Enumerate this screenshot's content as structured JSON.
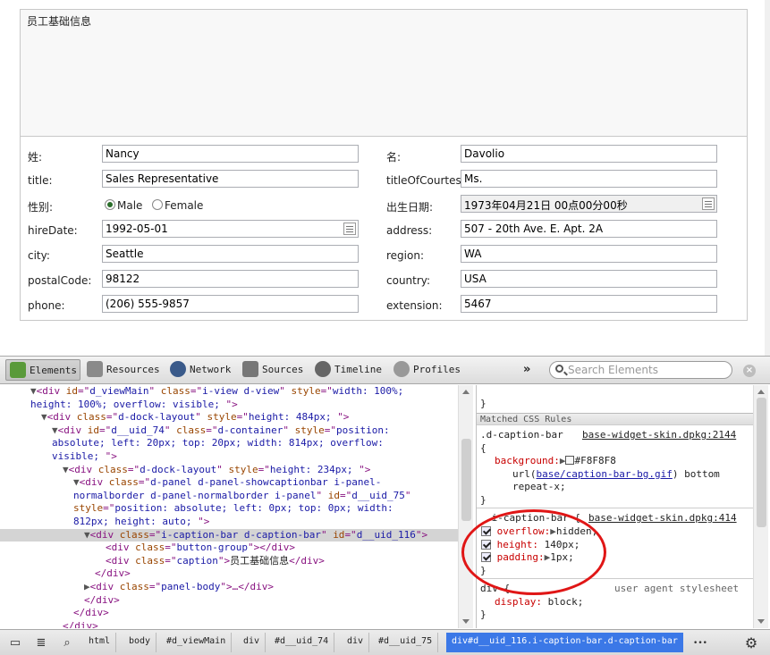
{
  "panel": {
    "caption": "员工基础信息",
    "fields": {
      "lastname": {
        "label": "姓:",
        "value": "Nancy"
      },
      "firstname": {
        "label": "名:",
        "value": "Davolio"
      },
      "title": {
        "label": "title:",
        "value": "Sales Representative"
      },
      "titleOfCourtesy": {
        "label": "titleOfCourtesy",
        "value": "Ms."
      },
      "gender": {
        "label": "性别:",
        "male": "Male",
        "female": "Female",
        "selected": "Male"
      },
      "birthdate": {
        "label": "出生日期:",
        "value": "1973年04月21日 00点00分00秒"
      },
      "hireDate": {
        "label": "hireDate:",
        "value": "1992-05-01"
      },
      "address": {
        "label": "address:",
        "value": "507 - 20th Ave. E. Apt. 2A"
      },
      "city": {
        "label": "city:",
        "value": "Seattle"
      },
      "region": {
        "label": "region:",
        "value": "WA"
      },
      "postalCode": {
        "label": "postalCode:",
        "value": "98122"
      },
      "country": {
        "label": "country:",
        "value": "USA"
      },
      "phone": {
        "label": "phone:",
        "value": "(206) 555-9857"
      },
      "extension": {
        "label": "extension:",
        "value": "5467"
      }
    }
  },
  "devtools": {
    "tabs": [
      {
        "label": "Elements",
        "icon": "elements-icon"
      },
      {
        "label": "Resources",
        "icon": "resources-icon"
      },
      {
        "label": "Network",
        "icon": "network-icon"
      },
      {
        "label": "Sources",
        "icon": "sources-icon"
      },
      {
        "label": "Timeline",
        "icon": "timeline-icon"
      },
      {
        "label": "Profiles",
        "icon": "profiles-icon"
      }
    ],
    "more": "»",
    "search_placeholder": "Search Elements",
    "dom": {
      "l1": {
        "t1": "▼",
        "a1": "<div ",
        "b1": "id",
        "c1": "=\"",
        "d1": "d_viewMain",
        "e1": "\" ",
        "f1": "class",
        "g1": "=\"",
        "h1": "i-view d-view",
        "i1": "\" ",
        "j1": "style",
        "k1": "=\"",
        "m1": "width: 100%;"
      },
      "l2": {
        "d": "height: 100%; overflow: visible; ",
        "e": "\">"
      },
      "l3": {
        "t": "▼",
        "a": "<div ",
        "b": "class",
        "d": "d-dock-layout",
        "f": "style",
        "h": "height: 484px; ",
        "z": "\">"
      },
      "l4": {
        "t": "▼",
        "a": "<div ",
        "b": "id",
        "d": "d__uid_74",
        "f": "class",
        "h": "d-container",
        "j": "style",
        "m": "position:"
      },
      "l5": {
        "d": "absolute; left: 20px; top: 20px; width: 814px; overflow:"
      },
      "l6": {
        "d": "visible; ",
        "e": "\">"
      },
      "l7": {
        "t": "▼",
        "a": "<div ",
        "b": "class",
        "d": "d-dock-layout",
        "f": "style",
        "h": "height: 234px; ",
        "z": "\">"
      },
      "l8": {
        "t": "▼",
        "a": "<div ",
        "b": "class",
        "d": "d-panel d-panel-showcaptionbar i-panel-"
      },
      "l9": {
        "d": "normalborder d-panel-normalborder i-panel",
        "f": "id",
        "h": "d__uid_75"
      },
      "l10": {
        "b": "style",
        "d": "position: absolute; left: 0px; top: 0px; width:"
      },
      "l11": {
        "d": "812px; height: auto; ",
        "e": "\">"
      },
      "l12": {
        "t": "▼",
        "a": "<div ",
        "b": "class",
        "d": "i-caption-bar d-caption-bar",
        "f": "id",
        "h": "d__uid_116",
        "z": "\">"
      },
      "l13": {
        "a": "<div ",
        "b": "class",
        "d": "button-group",
        "z": "\"></div>"
      },
      "l14": {
        "a": "<div ",
        "b": "class",
        "d": "caption",
        "z": "\">",
        "tx": "员工基础信息",
        "c": "</div>"
      },
      "l15": {
        "a": "</div>"
      },
      "l16": {
        "t": "▶",
        "a": "<div ",
        "b": "class",
        "d": "panel-body",
        "z": "\">…</div>"
      },
      "l17": {
        "a": "</div>"
      },
      "l18": {
        "a": "</div>"
      },
      "l19": {
        "a": "</div>"
      }
    },
    "styles": {
      "brace_close_top": "}",
      "matched_header": "Matched CSS Rules",
      "rule1_selector": ".d-caption-bar",
      "rule1_source": "base-widget-skin.dpkg:2144",
      "rule1_open": "{",
      "rule1_prop": "background:",
      "rule1_color": "#F8F8F8",
      "rule1_url_pre": "url(",
      "rule1_url": "base/caption-bar-bg.gif",
      "rule1_url_post": ") bottom",
      "rule1_repeat": "repeat-x;",
      "rule1_close": "}",
      "rule2_selector": ".i-caption-bar {",
      "rule2_source": "base-widget-skin.dpkg:414",
      "rule2_p1": "overflow:",
      "rule2_v1": "hidden;",
      "rule2_p2": "height:",
      "rule2_v2": "140px;",
      "rule2_p3": "padding:",
      "rule2_v3": "1px;",
      "rule2_close": "}",
      "rule3_selector": "div {",
      "rule3_source": "user agent stylesheet",
      "rule3_p": "display:",
      "rule3_v": "block;",
      "rule3_close": "}"
    },
    "breadcrumbs": [
      "html",
      "body",
      "#d_viewMain",
      "div",
      "#d__uid_74",
      "div",
      "#d__uid_75",
      "div#d__uid_116.i-caption-bar.d-caption-bar"
    ],
    "status_more": "•••",
    "colors": {
      "accent": "#3b78e7",
      "annotation": "#e01616"
    }
  }
}
